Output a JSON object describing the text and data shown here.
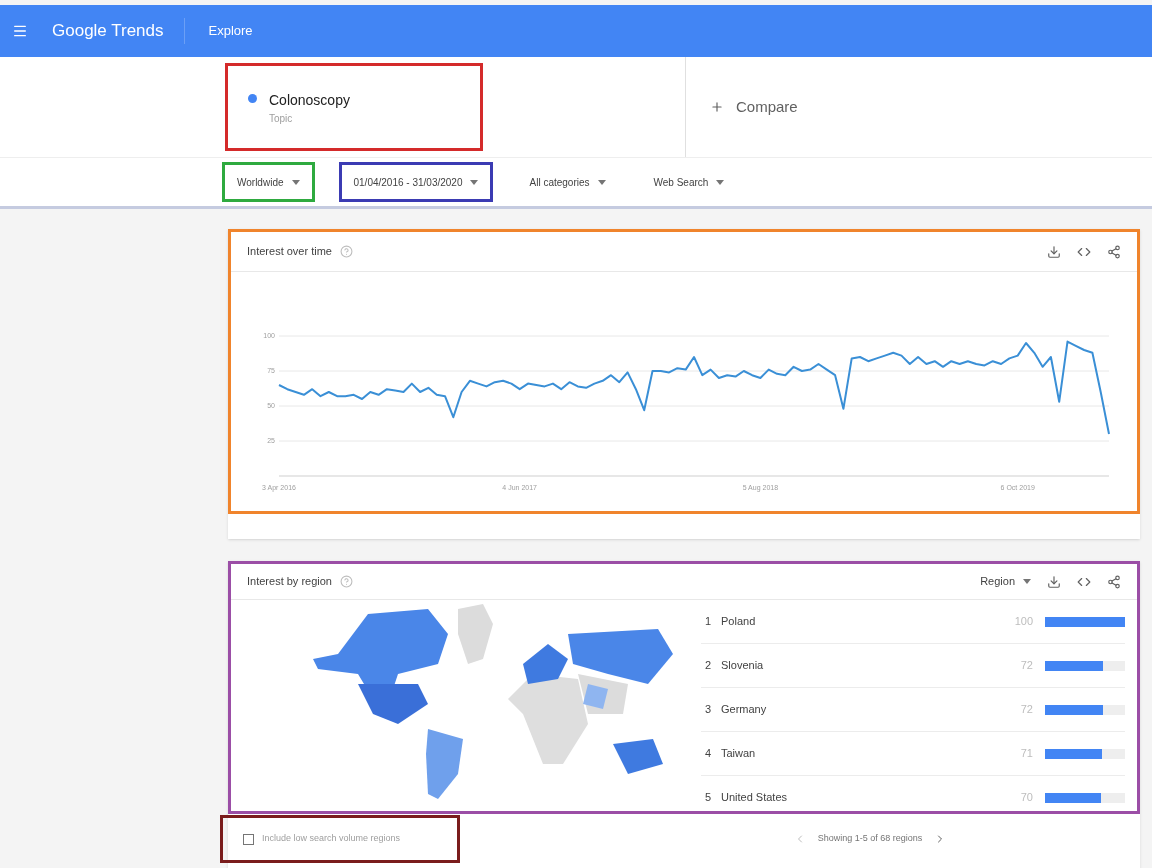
{
  "header": {
    "logo": "Google Trends",
    "section": "Explore"
  },
  "search_term": {
    "name": "Colonoscopy",
    "type": "Topic",
    "color": "#4285f4"
  },
  "compare": {
    "label": "Compare"
  },
  "filters": [
    {
      "label": "Worldwide"
    },
    {
      "label": "01/04/2016 - 31/03/2020"
    },
    {
      "label": "All categories"
    },
    {
      "label": "Web Search"
    }
  ],
  "interest_over_time": {
    "title": "Interest over time",
    "chart_data": {
      "type": "line",
      "grid": true,
      "ylim": [
        0,
        100
      ],
      "yticks": [
        25,
        50,
        75,
        100
      ],
      "categories": [
        "3 Apr 2016",
        null,
        null,
        null,
        null,
        null,
        null,
        null,
        null,
        null,
        null,
        null,
        null,
        null,
        null,
        null,
        null,
        null,
        null,
        null,
        null,
        null,
        null,
        null,
        null,
        null,
        null,
        null,
        null,
        "4 Jun 2017",
        null,
        null,
        null,
        null,
        null,
        null,
        null,
        null,
        null,
        null,
        null,
        null,
        null,
        null,
        null,
        null,
        null,
        null,
        null,
        null,
        null,
        null,
        null,
        null,
        null,
        null,
        null,
        null,
        "5 Aug 2018",
        null,
        null,
        null,
        null,
        null,
        null,
        null,
        null,
        null,
        null,
        null,
        null,
        null,
        null,
        null,
        null,
        null,
        null,
        null,
        null,
        null,
        null,
        null,
        null,
        null,
        null,
        null,
        null,
        null,
        null,
        "6 Oct 2019",
        null,
        null,
        null,
        null,
        null,
        null,
        null,
        null,
        null,
        null,
        null
      ],
      "series": [
        {
          "color": "#3a8fd6",
          "values": [
            65,
            62,
            60,
            58,
            62,
            57,
            60,
            57,
            57,
            58,
            55,
            60,
            58,
            62,
            61,
            60,
            66,
            60,
            63,
            58,
            57,
            42,
            60,
            68,
            66,
            64,
            67,
            68,
            66,
            62,
            66,
            65,
            64,
            66,
            62,
            67,
            64,
            63,
            66,
            68,
            72,
            67,
            74,
            62,
            47,
            75,
            75,
            74,
            77,
            76,
            85,
            72,
            76,
            70,
            72,
            71,
            75,
            72,
            70,
            76,
            73,
            72,
            78,
            75,
            76,
            80,
            76,
            72,
            48,
            84,
            85,
            82,
            84,
            86,
            88,
            86,
            80,
            85,
            80,
            82,
            78,
            82,
            80,
            82,
            80,
            79,
            82,
            80,
            84,
            86,
            95,
            88,
            78,
            85,
            53,
            96,
            93,
            90,
            88,
            60,
            30
          ]
        }
      ]
    }
  },
  "interest_by_region": {
    "title": "Interest by region",
    "resolution": "Region",
    "regions": [
      {
        "rank": "1",
        "name": "Poland",
        "value": "100",
        "level": 1.0
      },
      {
        "rank": "2",
        "name": "Slovenia",
        "value": "72",
        "level": 0.72
      },
      {
        "rank": "3",
        "name": "Germany",
        "value": "72",
        "level": 0.72
      },
      {
        "rank": "4",
        "name": "Taiwan",
        "value": "71",
        "level": 0.71
      },
      {
        "rank": "5",
        "name": "United States",
        "value": "70",
        "level": 0.7
      }
    ],
    "low_volume": {
      "label": "Include low search volume regions",
      "checked": false
    },
    "pagination": "Showing 1-5 of 68 regions"
  }
}
